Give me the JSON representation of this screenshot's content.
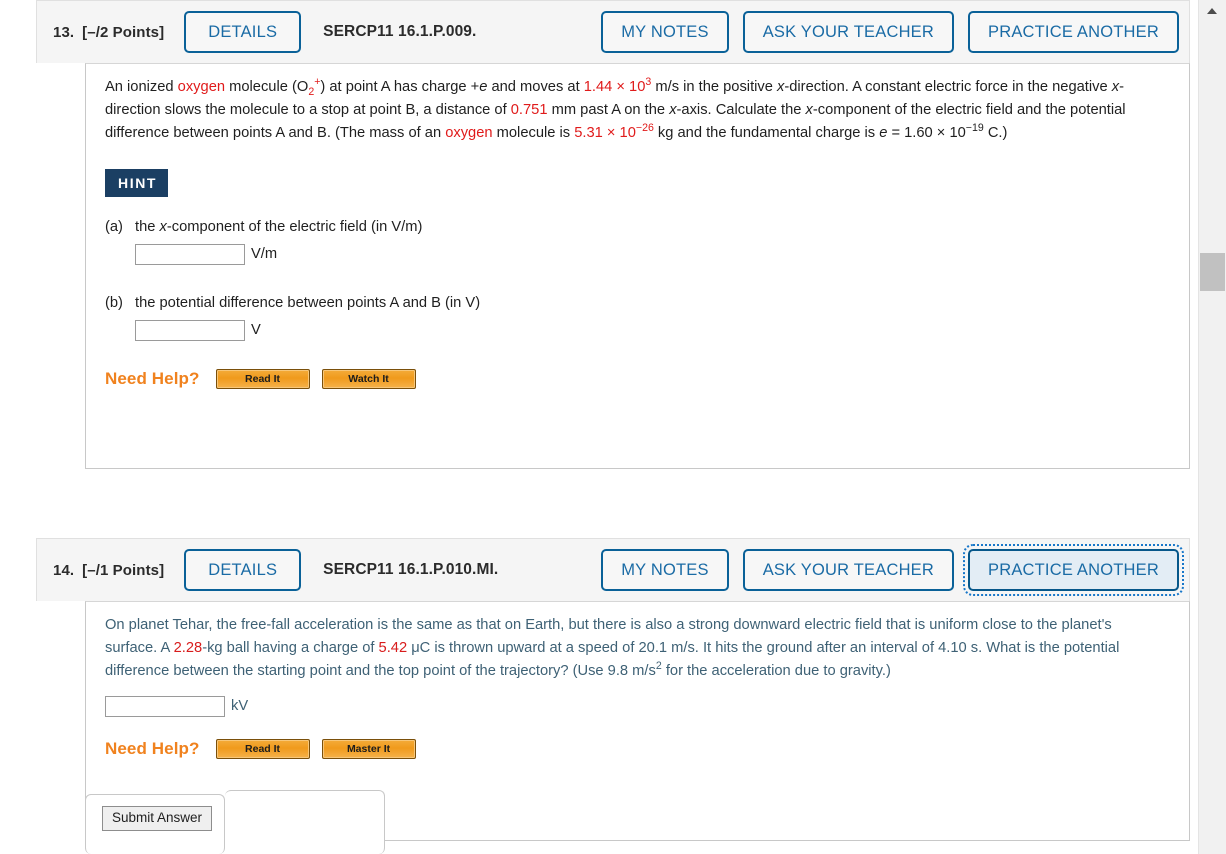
{
  "questions": [
    {
      "number": "13.",
      "points": "[–/2 Points]",
      "details_label": "DETAILS",
      "code": "SERCP11 16.1.P.009.",
      "my_notes_label": "MY NOTES",
      "ask_teacher_label": "ASK YOUR TEACHER",
      "practice_another_label": "PRACTICE ANOTHER",
      "hint_label": "HINT",
      "text": {
        "s1": "An ionized ",
        "v_oxygen1": "oxygen",
        "s2": " molecule (O",
        "sub_2": "2",
        "sup_plus": "+",
        "s3": ") at point A has charge +",
        "i_e1": "e",
        "s4": " and moves at ",
        "v_speed": "1.44 × 10",
        "v_speed_exp": "3",
        "s5": " m/s in the positive ",
        "i_x1": "x",
        "s6": "-direction. A constant electric force in the negative ",
        "i_x2": "x",
        "s7": "-direction slows the molecule to a stop at point B, a distance of ",
        "v_dist": "0.751",
        "s8": " mm past A on the ",
        "i_x3": "x",
        "s9": "-axis. Calculate the ",
        "i_x4": "x",
        "s10": "-component of the electric field and the potential difference between points A and B. (The mass of an ",
        "v_oxygen2": "oxygen",
        "s11": " molecule is ",
        "v_mass": "5.31 × 10",
        "v_mass_exp": "−26",
        "s12": " kg and the fundamental charge is ",
        "i_e2": "e",
        "s13": " = 1.60 × 10",
        "v_charge_exp": "−19",
        "s14": " C.)"
      },
      "parts": [
        {
          "label": "(a)",
          "prompt_pre": "the ",
          "prompt_i": "x",
          "prompt_post": "-component of the electric field (in V/m)",
          "input_value": "",
          "unit": "V/m"
        },
        {
          "label": "(b)",
          "prompt_pre": "the potential difference between points A and B (in V)",
          "prompt_i": "",
          "prompt_post": "",
          "input_value": "",
          "unit": "V"
        }
      ],
      "need_help_label": "Need Help?",
      "help_buttons": [
        "Read It",
        "Watch It"
      ]
    },
    {
      "number": "14.",
      "points": "[–/1 Points]",
      "details_label": "DETAILS",
      "code": "SERCP11 16.1.P.010.MI.",
      "my_notes_label": "MY NOTES",
      "ask_teacher_label": "ASK YOUR TEACHER",
      "practice_another_label": "PRACTICE ANOTHER",
      "text": {
        "s1": "On planet Tehar, the free-fall acceleration is the same as that on Earth, but there is also a strong downward electric field that is uniform close to the planet's surface. A ",
        "v_mass": "2.28",
        "s2": "-kg ball having a charge of ",
        "v_charge": "5.42",
        "s3": " μC is thrown upward at a speed of 20.1 m/s. It hits the ground after an interval of 4.10 s. What is the potential difference between the starting point and the top point of the trajectory? (Use 9.8 m/s",
        "sup_2": "2",
        "s4": " for the acceleration due to gravity.)"
      },
      "input_value": "",
      "unit": "kV",
      "need_help_label": "Need Help?",
      "help_buttons": [
        "Read It",
        "Master It"
      ]
    }
  ],
  "submit": {
    "label": "Submit Answer"
  },
  "scrollbar": {
    "up_arrow": "scroll-up-arrow"
  }
}
